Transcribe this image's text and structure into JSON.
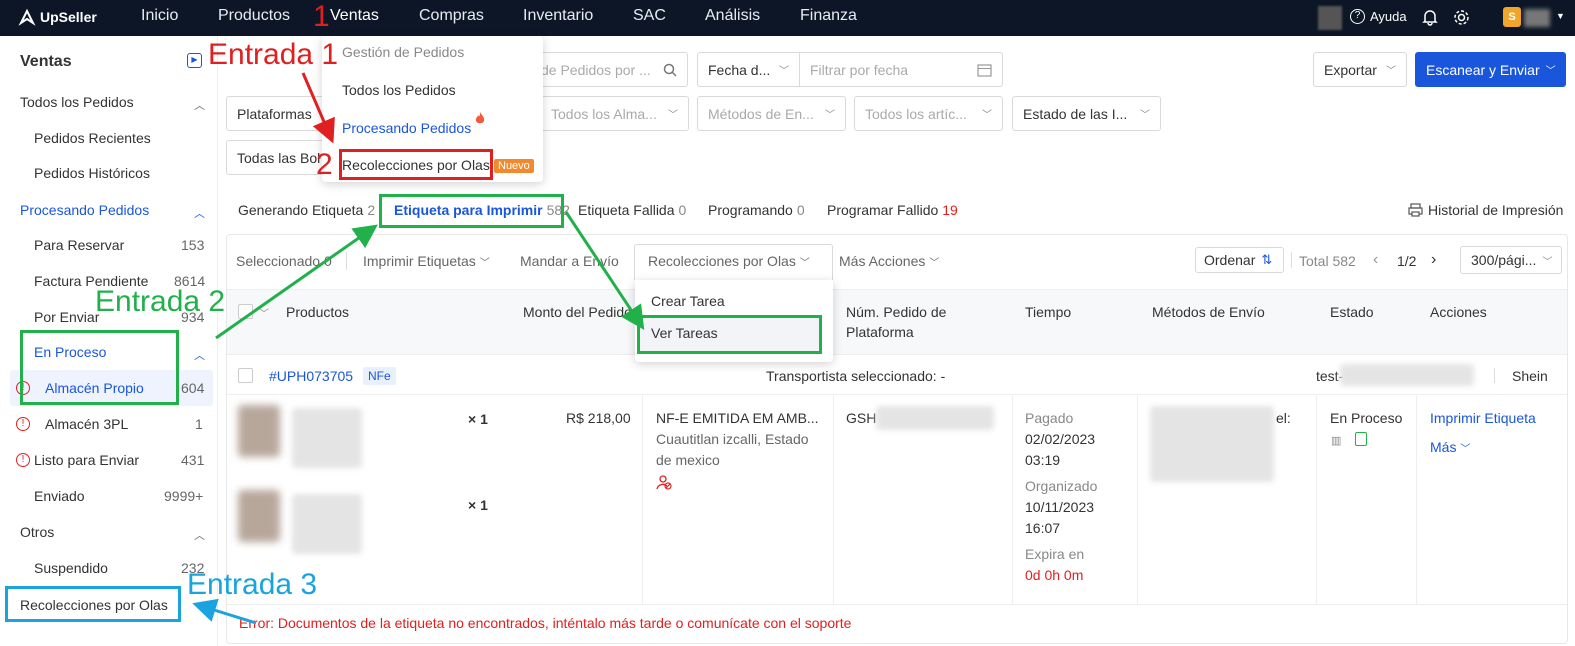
{
  "app": {
    "name": "UpSeller"
  },
  "topnav": {
    "items": [
      "Inicio",
      "Productos",
      "Ventas",
      "Compras",
      "Inventario",
      "SAC",
      "Análisis",
      "Finanza"
    ],
    "help": "Ayuda"
  },
  "sidebar": {
    "title": "Ventas",
    "all": "Todos los Pedidos",
    "recent": "Pedidos Recientes",
    "history": "Pedidos Históricos",
    "processing": "Procesando Pedidos",
    "reserve": "Para Reservar",
    "reserve_n": "153",
    "invoice": "Factura Pendiente",
    "invoice_n": "8614",
    "tosend": "Por Enviar",
    "tosend_n": "934",
    "inprocess": "En Proceso",
    "own": "Almacén Propio",
    "own_n": "604",
    "wh3pl": "Almacén 3PL",
    "wh3pl_n": "1",
    "ready": "Listo para Enviar",
    "ready_n": "431",
    "sent": "Enviado",
    "sent_n": "9999+",
    "others": "Otros",
    "suspended": "Suspendido",
    "suspended_n": "232",
    "waves": "Recolecciones por Olas"
  },
  "filters": {
    "search_ph": "de Pedidos por ...",
    "date": "Fecha d...",
    "date_ph": "Filtrar por fecha",
    "export": "Exportar",
    "scan": "Escanear y Enviar",
    "platforms": "Plataformas",
    "warehouses": "Todos los Alma...",
    "shipping": "Métodos de En...",
    "items": "Todos los artíc...",
    "status": "Estado de las I...",
    "bags": "Todas las Bol"
  },
  "dropdown": {
    "header": "Gestión de Pedidos",
    "all": "Todos los Pedidos",
    "processing": "Procesando Pedidos",
    "waves": "Recolecciones por Olas",
    "new_badge": "Nuevo"
  },
  "tabs": [
    {
      "label": "Generando Etiqueta",
      "n": "2"
    },
    {
      "label": "Etiqueta para Imprimir",
      "n": "582"
    },
    {
      "label": "Etiqueta Fallida",
      "n": "0"
    },
    {
      "label": "Programando",
      "n": "0"
    },
    {
      "label": "Programar Fallido",
      "n": "19"
    }
  ],
  "print_history": "Historial de Impresión",
  "toolbar": {
    "selected": "Seleccionado 0",
    "print": "Imprimir Etiquetas",
    "send": "Mandar a Envío",
    "waves": "Recolecciones por Olas",
    "more": "Más Acciones",
    "sort": "Ordenar",
    "total": "Total 582",
    "page": "1/2",
    "per_page": "300/pági..."
  },
  "wave_menu": {
    "create": "Crear Tarea",
    "view": "Ver Tareas"
  },
  "columns": {
    "products": "Productos",
    "amount": "Monto del Pedido",
    "platform_no": "Núm. Pedido de Plataforma",
    "time": "Tiempo",
    "shipping": "Métodos de Envío",
    "status": "Estado",
    "actions": "Acciones"
  },
  "order": {
    "id": "#UPH073705",
    "nfe": "NFe",
    "carrier": "Transportista seleccionado: -",
    "test": "test-",
    "shop": "Shein",
    "qty1": "× 1",
    "qty2": "× 1",
    "amount": "R$ 218,00",
    "addr1": "NF-E EMITIDA EM AMB...",
    "addr2": "Cuautitlan izcalli, Estado",
    "addr3": "de mexico",
    "gsh": "GSH",
    "paid": "Pagado",
    "paid_date": "02/02/2023",
    "paid_time": "03:19",
    "org": "Organizado",
    "org_date": "10/11/2023",
    "org_time": "16:07",
    "exp": "Expira en",
    "exp_val": "0d 0h 0m",
    "tel": "el:",
    "status": "En Proceso",
    "print": "Imprimir Etiqueta",
    "more": "Más",
    "error_prefix": "Error:",
    "error": "Documentos de la etiqueta no encontrados, inténtalo más tarde o comunícate con el soporte"
  },
  "annotations": {
    "num1": "1",
    "entrada1": "Entrada 1",
    "num2": "2",
    "entrada2": "Entrada 2",
    "entrada3": "Entrada 3"
  },
  "colors": {
    "topbar": "#0c1626",
    "primary": "#1a56db",
    "red": "#e02020",
    "green": "#22b04a",
    "blue": "#1ba3e0"
  }
}
